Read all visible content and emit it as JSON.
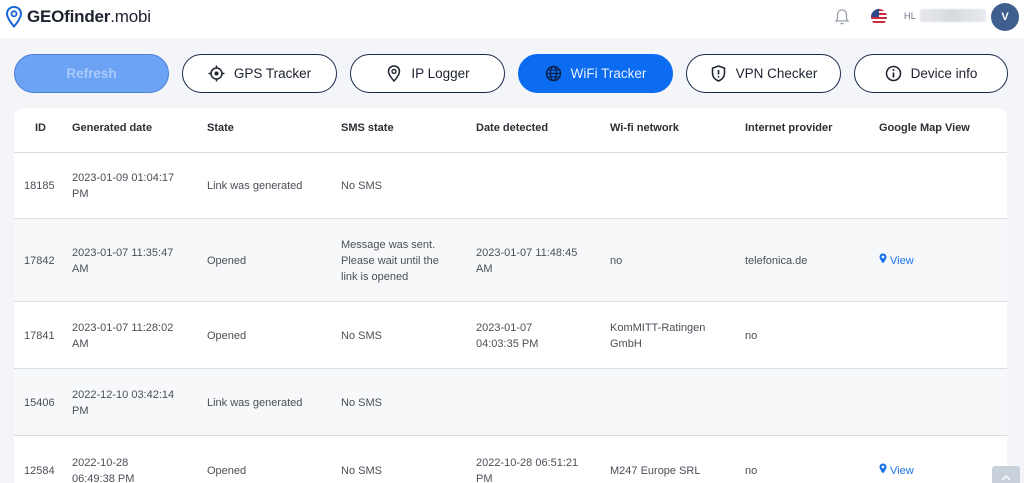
{
  "header": {
    "brand_main": "GEOfinder",
    "brand_tld": ".mobi",
    "user_initials": "HL",
    "avatar_letter": "V"
  },
  "toolbar": {
    "refresh_label": "Refresh",
    "gps_label": "GPS Tracker",
    "ip_label": "IP Logger",
    "wifi_label": "WiFi Tracker",
    "vpn_label": "VPN Checker",
    "device_label": "Device info",
    "active_tab": "WiFi Tracker"
  },
  "table": {
    "columns": [
      "ID",
      "Generated date",
      "State",
      "SMS state",
      "Date detected",
      "Wi-fi network",
      "Internet provider",
      "Google Map View"
    ],
    "rows": [
      {
        "id": "18185",
        "generated": [
          "2023-01-09 01:04:17",
          "PM"
        ],
        "state": "Link was generated",
        "sms": [
          "No SMS"
        ],
        "detected": [],
        "wifi": [],
        "provider": "",
        "map": ""
      },
      {
        "id": "17842",
        "generated": [
          "2023-01-07 11:35:47",
          "AM"
        ],
        "state": "Opened",
        "sms": [
          "Message was sent.",
          "Please wait until the",
          "link is opened"
        ],
        "detected": [
          "2023-01-07 11:48:45",
          "AM"
        ],
        "wifi": [
          "no"
        ],
        "provider": "telefonica.de",
        "map": "View"
      },
      {
        "id": "17841",
        "generated": [
          "2023-01-07 11:28:02",
          "AM"
        ],
        "state": "Opened",
        "sms": [
          "No SMS"
        ],
        "detected": [
          "2023-01-07",
          "04:03:35 PM"
        ],
        "wifi": [
          "KomMITT-Ratingen",
          "GmbH"
        ],
        "provider": "no",
        "map": ""
      },
      {
        "id": "15406",
        "generated": [
          "2022-12-10 03:42:14",
          "PM"
        ],
        "state": "Link was generated",
        "sms": [
          "No SMS"
        ],
        "detected": [],
        "wifi": [],
        "provider": "",
        "map": ""
      },
      {
        "id": "12584",
        "generated": [
          "2022-10-28",
          "06:49:38 PM"
        ],
        "state": "Opened",
        "sms": [
          "No SMS"
        ],
        "detected": [
          "2022-10-28 06:51:21",
          "PM"
        ],
        "wifi": [
          "M247 Europe SRL"
        ],
        "provider": "no",
        "map": "View"
      }
    ]
  },
  "colors": {
    "accent": "#0b6cf2",
    "refresh_bg": "#6da3f5",
    "link": "#1a73e8",
    "avatar": "#3f5f8f"
  },
  "icons": {
    "logo": "location-pin-icon",
    "bell": "bell-icon",
    "flag": "us-flag-icon",
    "gps": "crosshair-icon",
    "ip": "location-pin-icon",
    "wifi": "globe-icon",
    "vpn": "shield-icon",
    "device": "info-icon",
    "map": "map-pin-icon",
    "scroll": "arrow-up-icon"
  }
}
